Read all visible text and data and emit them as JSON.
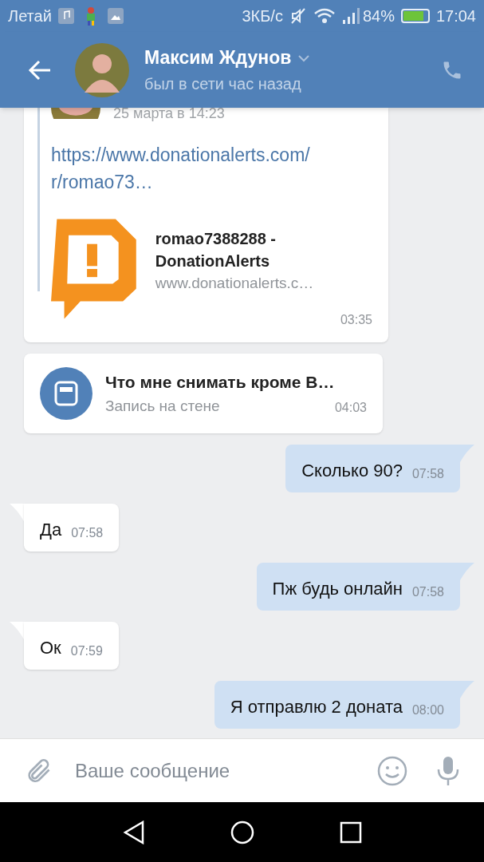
{
  "status_bar": {
    "carrier": "Летай",
    "speed": "3КБ/с",
    "battery_percent": "84%",
    "time": "17:04"
  },
  "header": {
    "name": "Максим Ждунов",
    "status": "был в сети час назад"
  },
  "messages": [
    {
      "kind": "repost",
      "date": "25 марта в 14:23",
      "link": "https://www.donationalerts.com/ r/romao73…",
      "preview_title": "romao7388288 - DonationAlerts",
      "preview_domain": "www.donationalerts.c…",
      "time": "03:35"
    },
    {
      "kind": "wall_post",
      "title": "Что мне снимать кроме В…",
      "subtitle": "Запись на стене",
      "time": "04:03"
    },
    {
      "kind": "text",
      "outgoing": true,
      "text": "Сколько 90?",
      "time": "07:58"
    },
    {
      "kind": "text",
      "outgoing": false,
      "text": "Да",
      "time": "07:58"
    },
    {
      "kind": "text",
      "outgoing": true,
      "text": "Пж будь онлайн",
      "time": "07:58"
    },
    {
      "kind": "text",
      "outgoing": false,
      "text": "Ок",
      "time": "07:59"
    },
    {
      "kind": "text",
      "outgoing": true,
      "text": "Я отправлю 2 доната",
      "time": "08:00"
    }
  ],
  "composer": {
    "placeholder": "Ваше сообщение"
  }
}
